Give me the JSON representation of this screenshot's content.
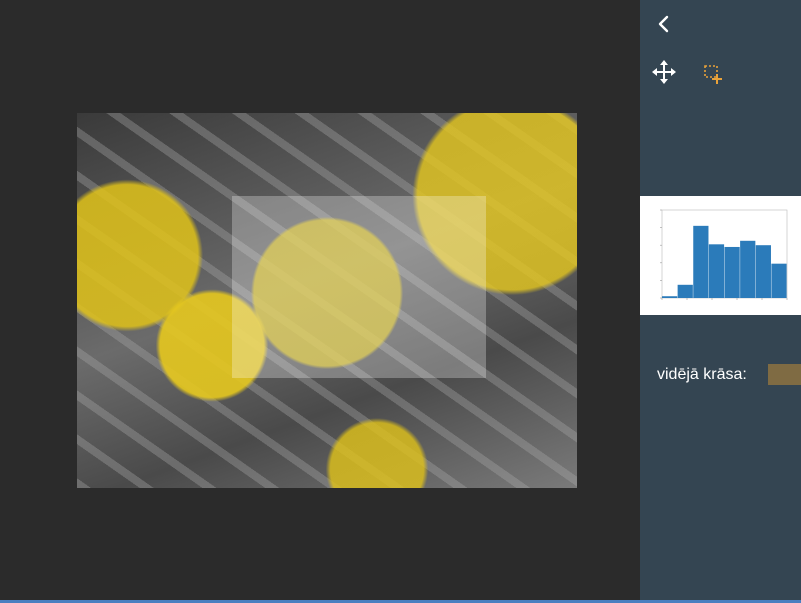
{
  "sidebar": {
    "back_icon": "chevron-left-icon",
    "tools": [
      {
        "name": "move",
        "icon": "move-arrows-icon",
        "color": "#ffffff"
      },
      {
        "name": "select-area",
        "icon": "add-selection-icon",
        "color": "#e8a23a"
      }
    ]
  },
  "histogram": {
    "type": "bar",
    "x": [
      0,
      32,
      64,
      96,
      128,
      160,
      192,
      224
    ],
    "values": [
      0.02,
      0.15,
      0.82,
      0.61,
      0.58,
      0.65,
      0.6,
      0.39
    ],
    "bar_color": "#2b7bba"
  },
  "average_color": {
    "label": "vidējā krāsa:",
    "value": "#7f6b43"
  },
  "colors": {
    "canvas_bg": "#2b2b2b",
    "sidebar_bg": "#344552"
  }
}
